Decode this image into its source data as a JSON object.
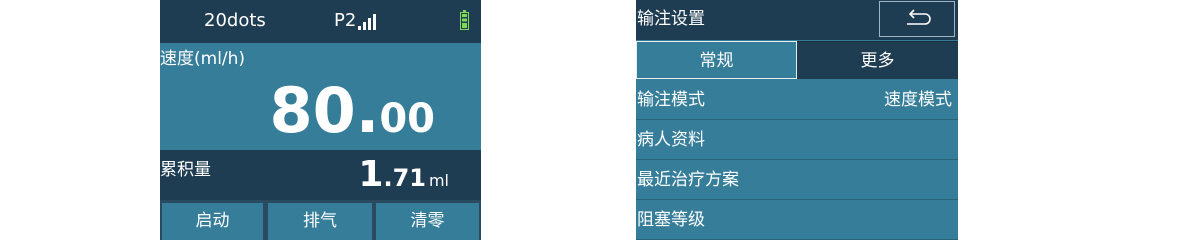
{
  "colors": {
    "panel_dark": "#1f3d52",
    "panel_accent": "#357d99",
    "background_mid": "#2a4a60",
    "text": "#ffffff",
    "battery": "#7ed957"
  },
  "left_screen": {
    "status_bar": {
      "device_name": "20dots",
      "profile": "P2",
      "signal_icon": "signal-bars-icon",
      "battery_icon": "battery-icon"
    },
    "speed": {
      "label": "速度(ml/h)",
      "value_int": "80",
      "value_sep": ".",
      "value_dec": "00"
    },
    "volume": {
      "label": "累积量",
      "value_int": "1",
      "value_dec": ".71",
      "unit": "ml"
    },
    "buttons": {
      "start": "启动",
      "purge": "排气",
      "clear": "清零"
    }
  },
  "right_screen": {
    "title": "输注设置",
    "back_icon": "return-arrow-icon",
    "tabs": [
      {
        "label": "常规",
        "active": true
      },
      {
        "label": "更多",
        "active": false
      }
    ],
    "items": [
      {
        "label": "输注模式",
        "value": "速度模式"
      },
      {
        "label": "病人资料",
        "value": ""
      },
      {
        "label": "最近治疗方案",
        "value": ""
      },
      {
        "label": "阻塞等级",
        "value": ""
      }
    ]
  }
}
